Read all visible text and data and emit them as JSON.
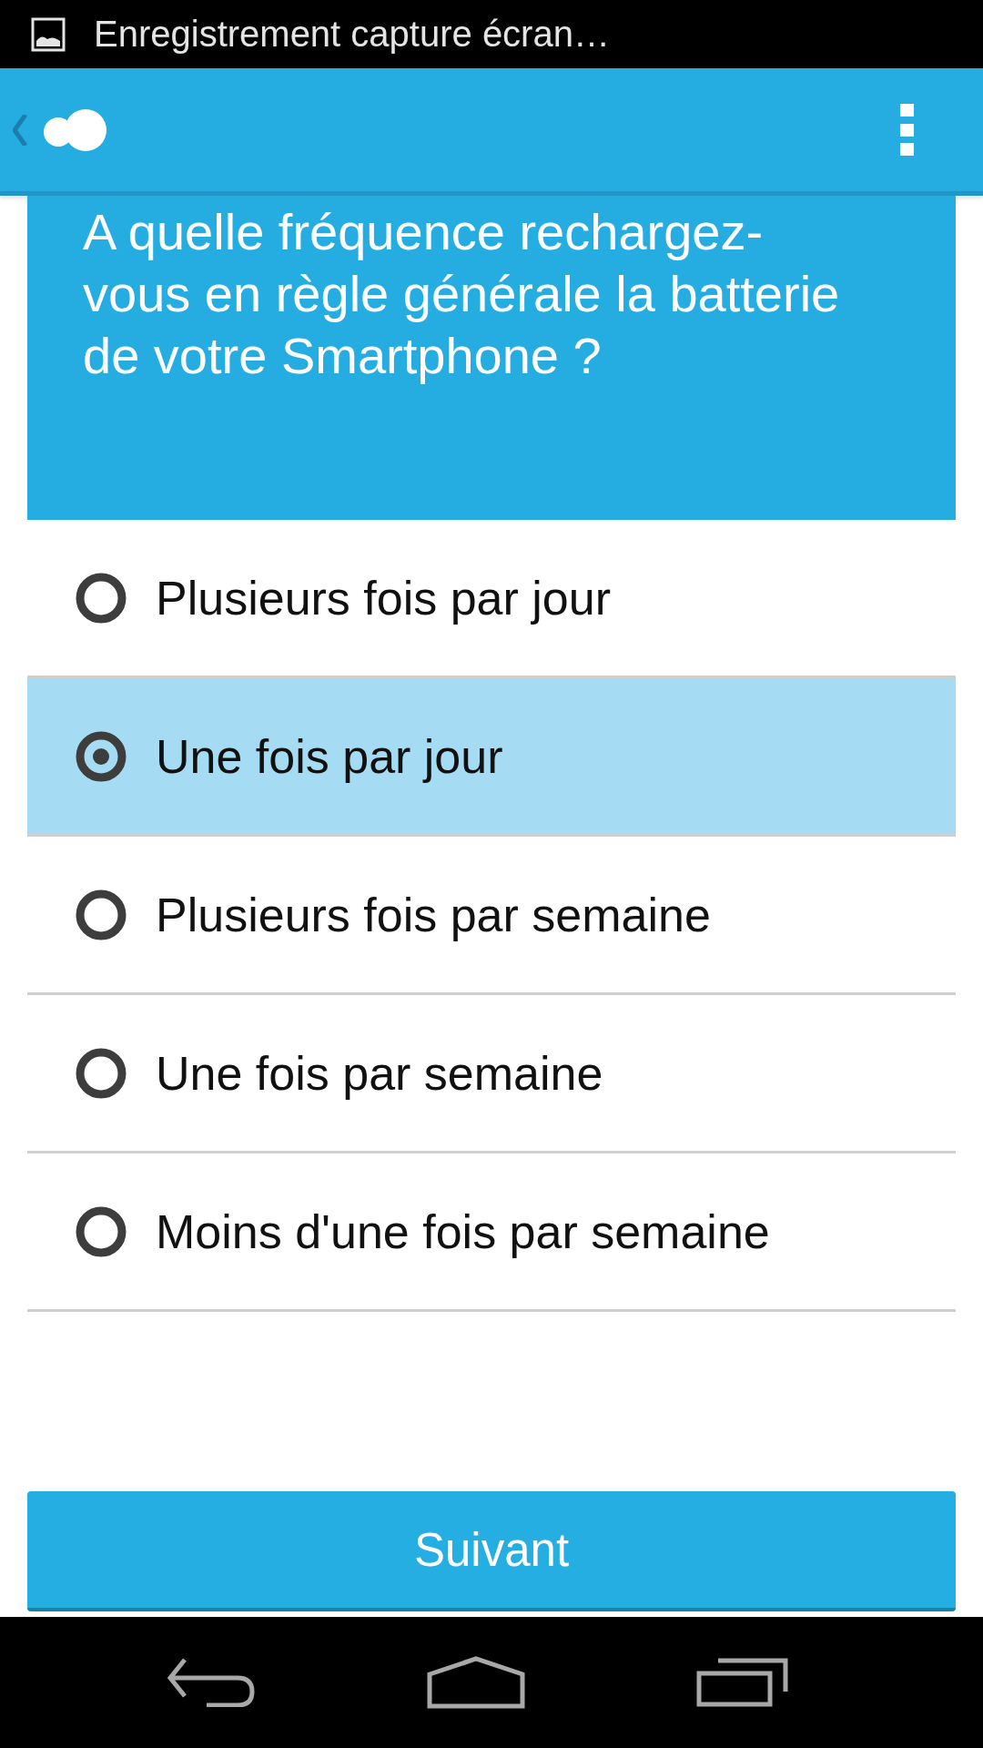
{
  "status_bar": {
    "notification": "Enregistrement capture écran…"
  },
  "question": {
    "text": "A quelle fréquence rechargez-vous en règle générale la batterie de votre Smartphone ?"
  },
  "options": [
    {
      "label": "Plusieurs fois par jour",
      "selected": false
    },
    {
      "label": "Une fois par jour",
      "selected": true
    },
    {
      "label": "Plusieurs fois par semaine",
      "selected": false
    },
    {
      "label": "Une fois par semaine",
      "selected": false
    },
    {
      "label": "Moins d'une fois par semaine",
      "selected": false
    }
  ],
  "next_button": {
    "label": "Suivant"
  }
}
